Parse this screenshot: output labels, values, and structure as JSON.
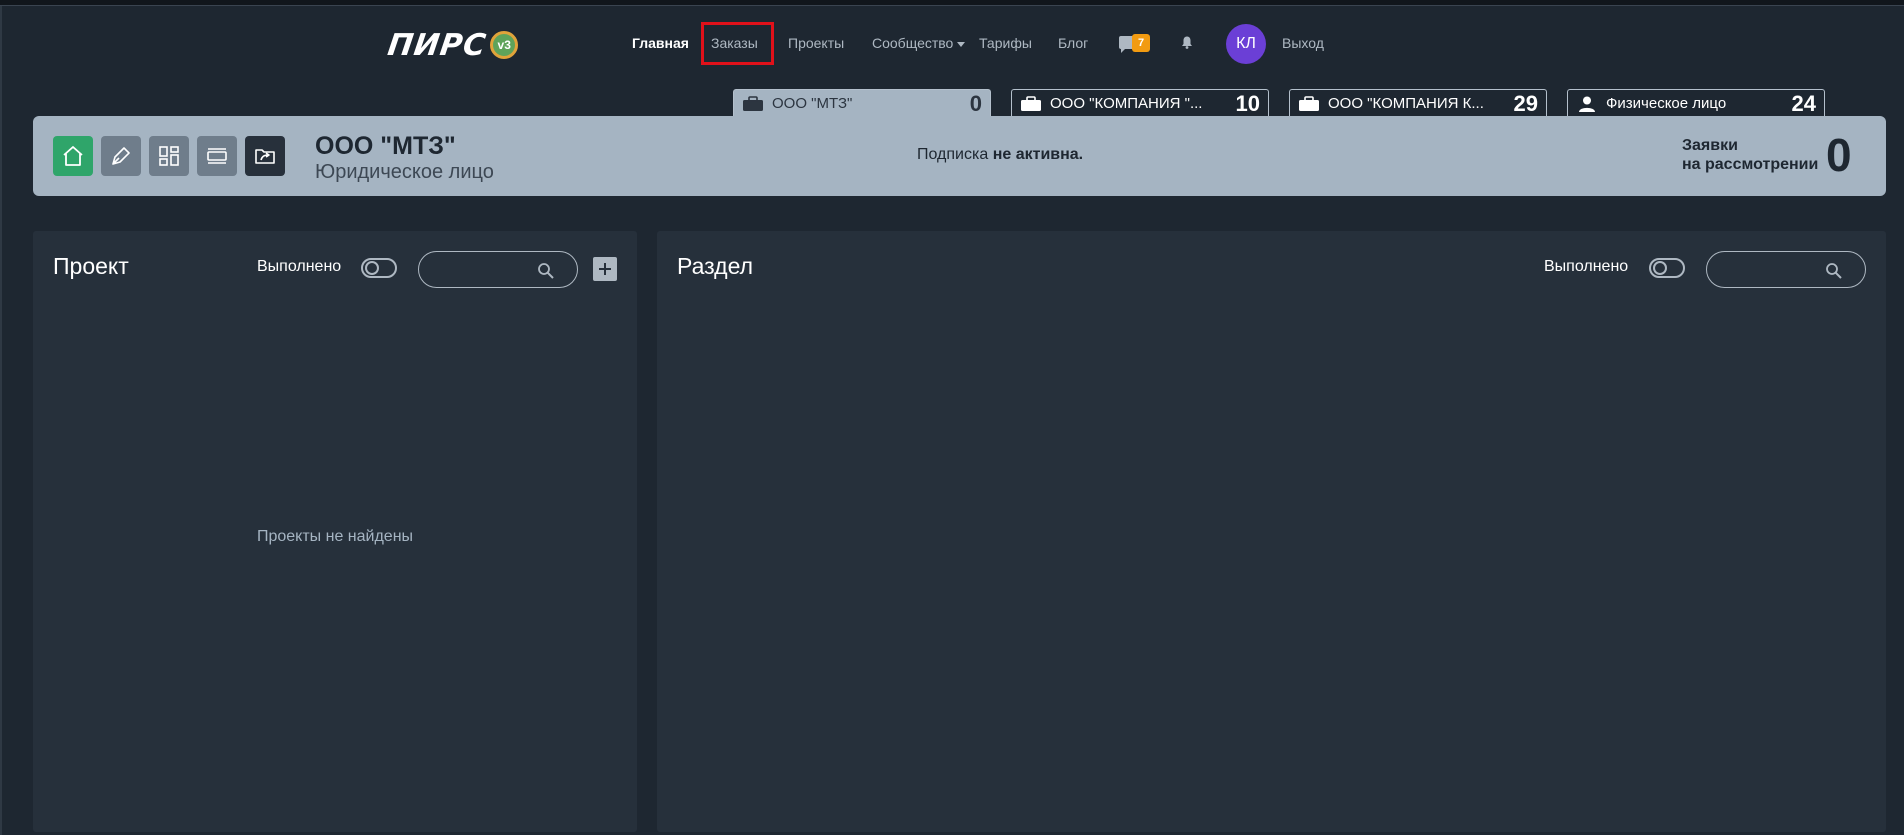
{
  "logo": {
    "text": "ПИРС",
    "version": "v3"
  },
  "nav": {
    "items": [
      {
        "label": "Главная",
        "active": true
      },
      {
        "label": "Заказы",
        "active": false,
        "highlighted": true
      },
      {
        "label": "Проекты",
        "active": false
      },
      {
        "label": "Сообщество",
        "active": false,
        "dropdown": true
      },
      {
        "label": "Тарифы",
        "active": false
      },
      {
        "label": "Блог",
        "active": false
      }
    ],
    "messages_badge": "7",
    "avatar_initials": "КЛ",
    "logout_label": "Выход"
  },
  "accounts": [
    {
      "name": "ООО \"МТЗ\"",
      "count": "0",
      "icon": "briefcase-icon",
      "active": true
    },
    {
      "name": "ООО \"КОМПАНИЯ \"...",
      "count": "10",
      "icon": "briefcase-icon",
      "active": false
    },
    {
      "name": "ООО \"КОМПАНИЯ К...",
      "count": "29",
      "icon": "briefcase-icon",
      "active": false
    },
    {
      "name": "Физическое лицо",
      "count": "24",
      "icon": "person-icon",
      "active": false
    }
  ],
  "company": {
    "name": "ООО \"МТЗ\"",
    "type": "Юридическое лицо",
    "subscription_prefix": "Подписка ",
    "subscription_status": "не активна.",
    "requests_label_line1": "Заявки",
    "requests_label_line2": "на рассмотрении",
    "requests_count": "0",
    "tools": [
      "home-icon",
      "pen-icon",
      "grid-icon",
      "layout-icon",
      "folder-share-icon"
    ]
  },
  "project_panel": {
    "title": "Проект",
    "done_label": "Выполнено",
    "search_placeholder": "",
    "empty_text": "Проекты не найдены"
  },
  "section_panel": {
    "title": "Раздел",
    "done_label": "Выполнено",
    "search_placeholder": ""
  },
  "colors": {
    "background": "#1e2731",
    "panel": "#26303b",
    "company_bar": "#a5b4c2",
    "highlight": "#e1111a",
    "badge": "#f29b11",
    "avatar": "#6b3fd6",
    "home_button": "#2fa56a"
  }
}
